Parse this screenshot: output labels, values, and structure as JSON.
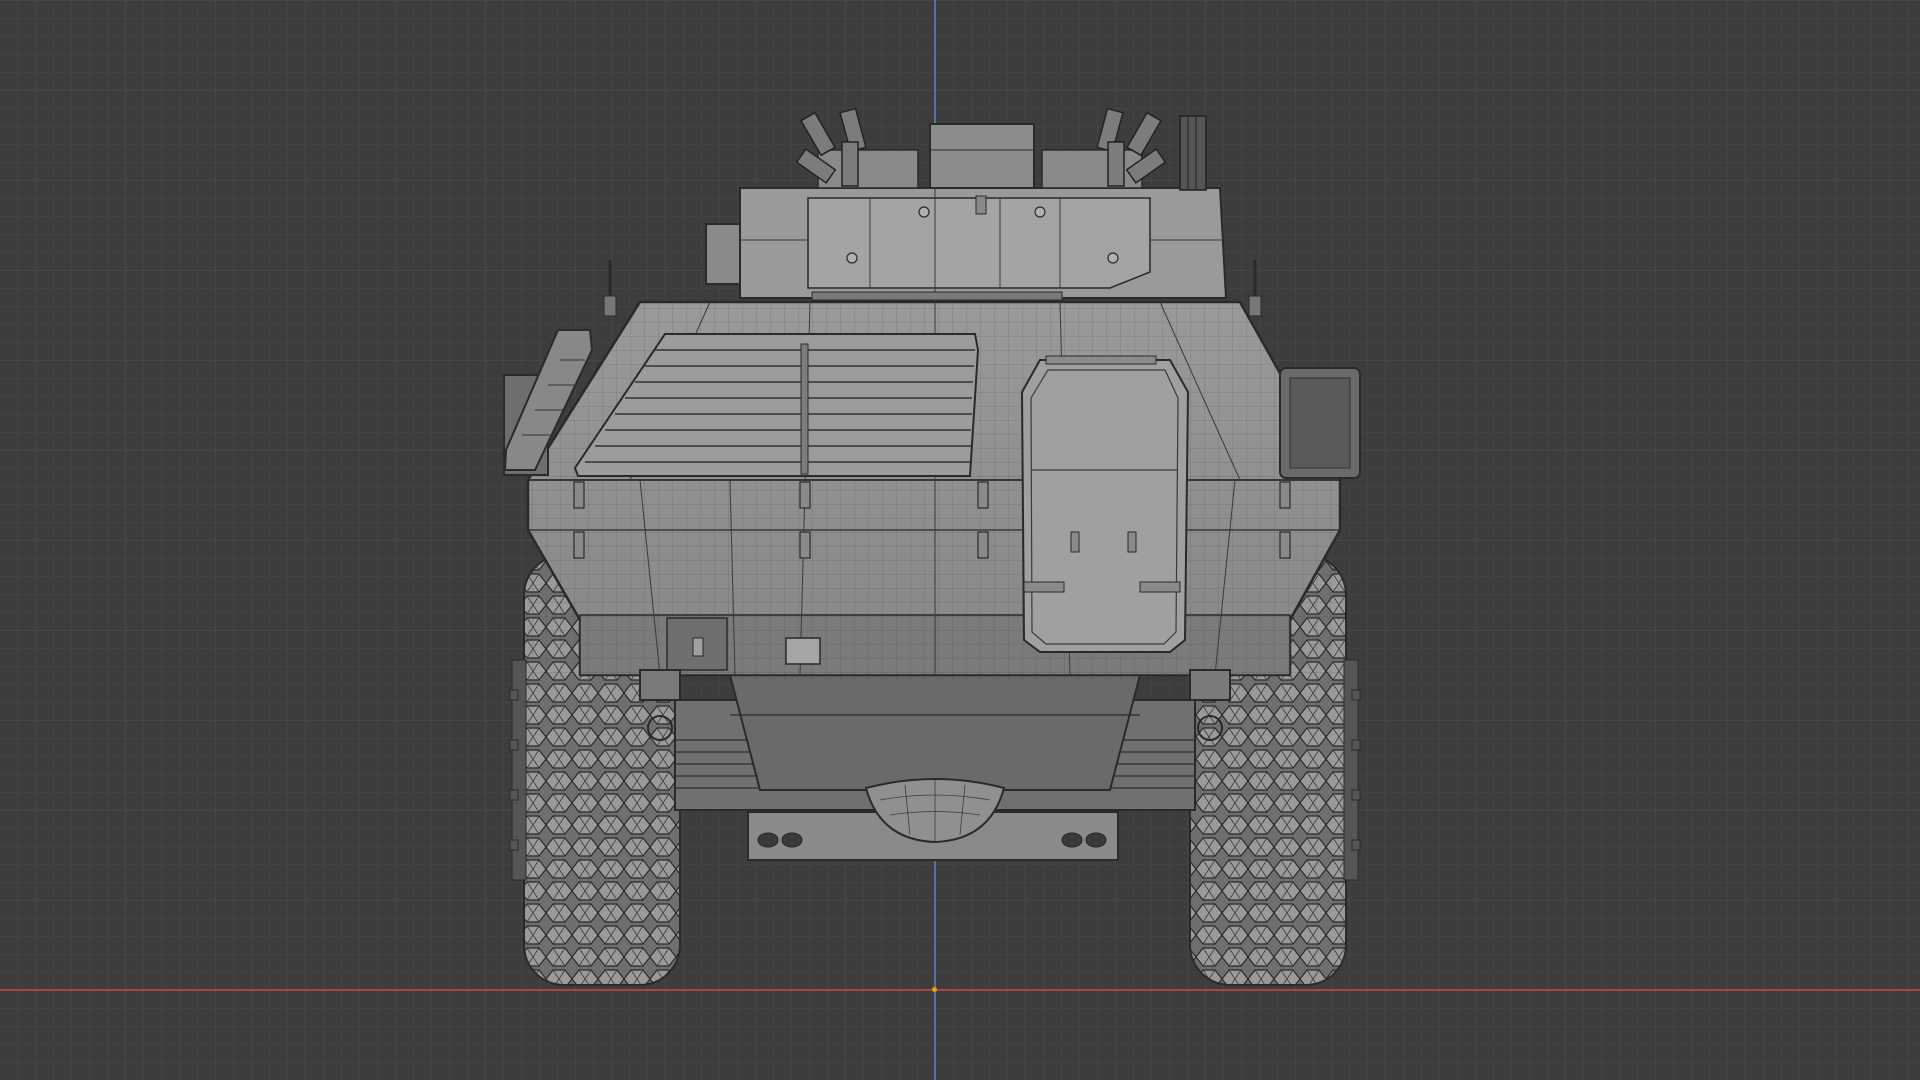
{
  "viewport": {
    "view": "front-orthographic",
    "shading": "solid-wireframe",
    "grid": true,
    "axes": [
      "x",
      "z"
    ],
    "colors": {
      "background": "#3d3d3d",
      "grid_major": "#474747",
      "grid_minor": "#434343",
      "axis_x": "#b8474f",
      "axis_z": "#4f7fb8",
      "model_light": "#8e8e8e",
      "model_mid": "#7a7a7a",
      "model_dark": "#5c5c5c",
      "wire": "#2a2a2a"
    }
  },
  "model": {
    "name_icon": "armored-vehicle-mesh",
    "parts": [
      "turret",
      "hull",
      "front-hatch",
      "left-wheel",
      "right-wheel",
      "bumper",
      "tow-hook",
      "smoke-launchers",
      "antennas",
      "mirrors"
    ]
  }
}
